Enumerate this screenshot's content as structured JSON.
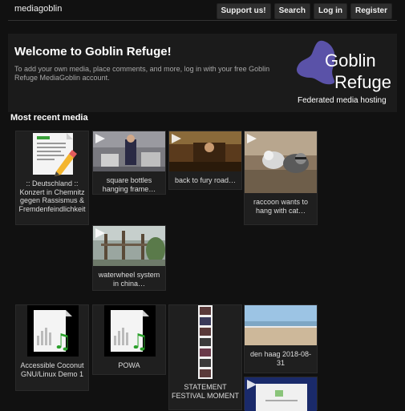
{
  "header": {
    "brand": "mediagoblin",
    "buttons": [
      "Support us!",
      "Search",
      "Log in",
      "Register"
    ]
  },
  "welcome": {
    "title": "Welcome to Goblin Refuge!",
    "text": "To add your own media, place comments, and more, log in with your free Goblin Refuge MediaGoblin account.",
    "logo_word1": "Goblin",
    "logo_word2": "Refuge",
    "logo_tagline": "Federated media hosting"
  },
  "recent": {
    "title": "Most recent media",
    "items": [
      {
        "caption": ":: Deutschland :: Konzert in Chemnitz gegen Rassismus & Fremdenfeindlichkeit",
        "kind": "document"
      },
      {
        "caption": "square bottles hanging frame…",
        "kind": "video"
      },
      {
        "caption": "back to fury road…",
        "kind": "video"
      },
      {
        "caption": "raccoon wants to hang with cat…",
        "kind": "video"
      },
      {
        "caption": "waterwheel system in china…",
        "kind": "video"
      },
      {
        "caption": "Accessible Coconut GNU/Linux Demo 1",
        "kind": "audio"
      },
      {
        "caption": "POWA",
        "kind": "audio"
      },
      {
        "caption": "STATEMENT FESTIVAL MOMENT",
        "kind": "image-strip"
      },
      {
        "caption": "den haag 2018-08-31",
        "kind": "image"
      },
      {
        "caption": "",
        "kind": "video"
      }
    ]
  },
  "colors": {
    "background": "#111111",
    "card": "#1f1f1f",
    "logo_purple": "#5a52a8"
  }
}
